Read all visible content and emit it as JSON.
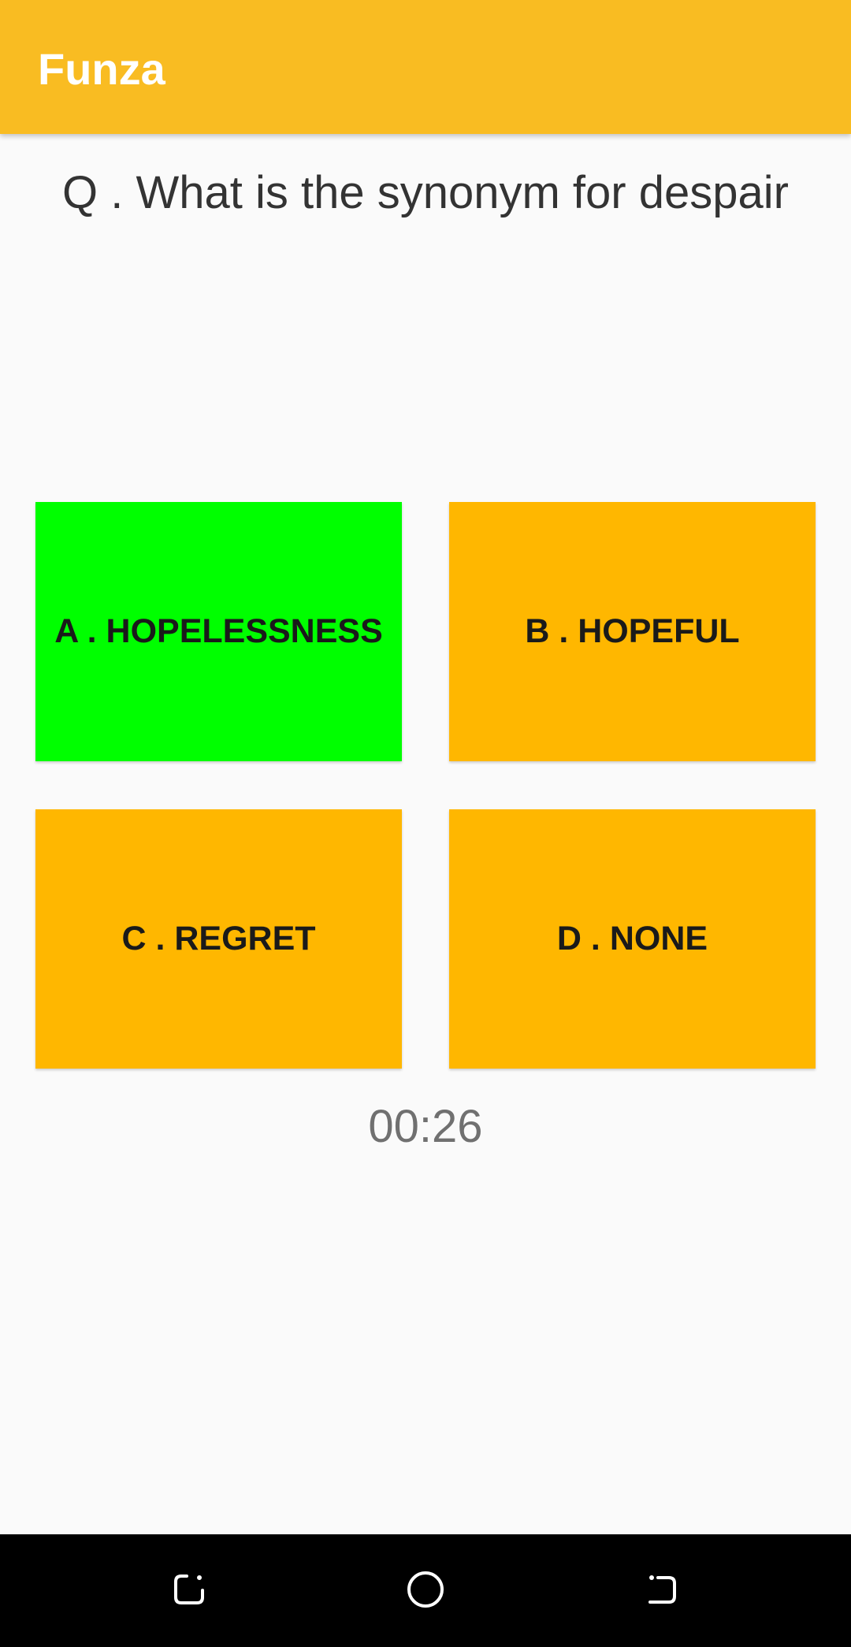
{
  "app_bar": {
    "title": "Funza",
    "color": "#F9BC22"
  },
  "question": {
    "text": "Q . What is the synonym for despair"
  },
  "options": [
    {
      "label": "A . HOPELESSNESS",
      "color": "#00FF00",
      "state": "correct"
    },
    {
      "label": "B . HOPEFUL",
      "color": "#FFB700",
      "state": "default"
    },
    {
      "label": "C . REGRET",
      "color": "#FFB700",
      "state": "default"
    },
    {
      "label": "D . NONE",
      "color": "#FFB700",
      "state": "default"
    }
  ],
  "timer": {
    "text": "00:26"
  },
  "nav_bar": {
    "icons": [
      "recent-apps-icon",
      "home-icon",
      "back-icon"
    ]
  }
}
